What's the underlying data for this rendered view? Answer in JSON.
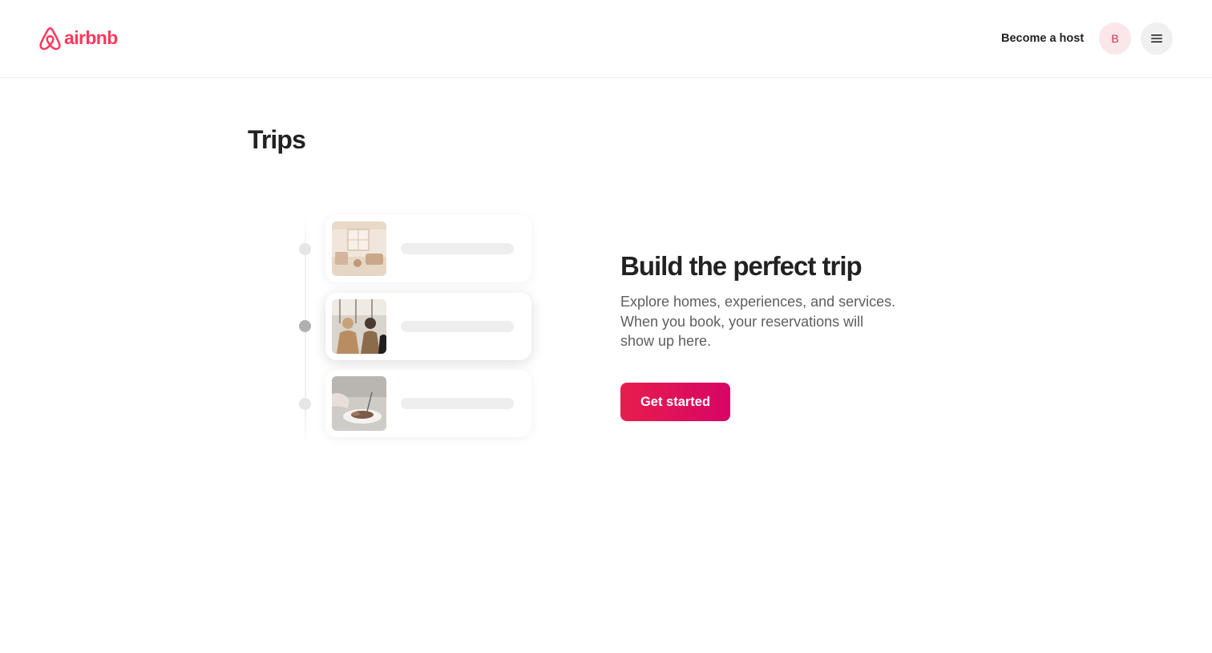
{
  "brand": {
    "name": "airbnb",
    "color": "#ff385c",
    "icon": "airbnb-logo-icon"
  },
  "header": {
    "become_host_label": "Become a host",
    "avatar_initial": "B",
    "menu_icon": "hamburger-menu-icon"
  },
  "page": {
    "title": "Trips"
  },
  "illustration": {
    "cards": [
      {
        "image": "room-interior-photo",
        "active": false
      },
      {
        "image": "people-sightseeing-photo",
        "active": true
      },
      {
        "image": "food-plate-photo",
        "active": false
      }
    ]
  },
  "empty_state": {
    "heading": "Build the perfect trip",
    "body_lines": [
      "Explore homes, experiences, and services.",
      "When you book, your reservations will",
      "show up here."
    ],
    "button_label": "Get started",
    "button_colors": [
      "#e61e4d",
      "#d70466"
    ]
  }
}
